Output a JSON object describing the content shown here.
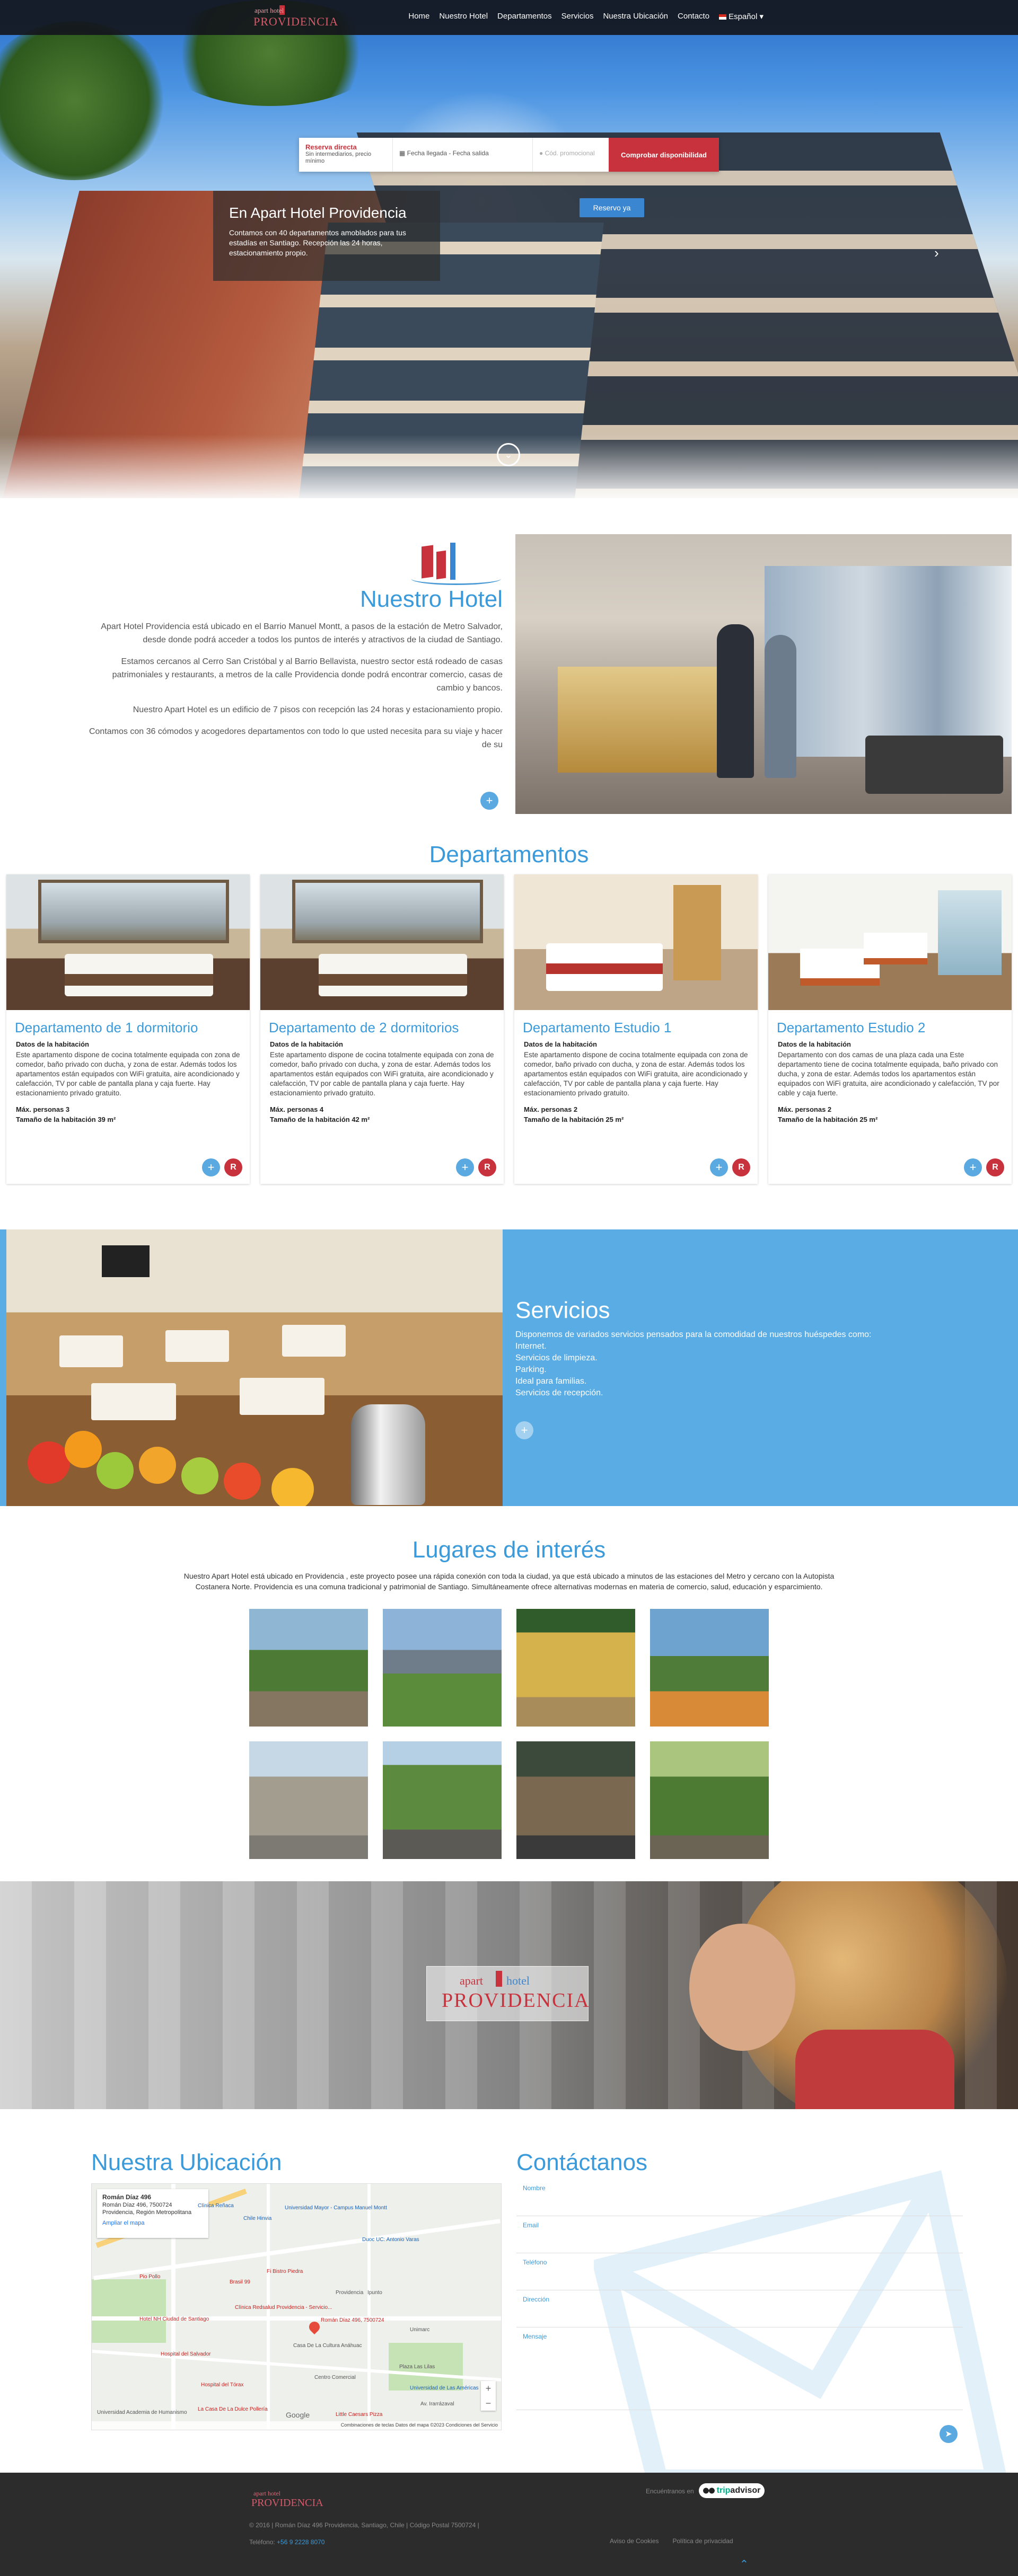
{
  "nav": {
    "logo_top": "apart hotel",
    "logo_main": "PROVIDENCIA",
    "items": [
      "Home",
      "Nuestro Hotel",
      "Departamentos",
      "Servicios",
      "Nuestra Ubicación",
      "Contacto"
    ],
    "language": "Español"
  },
  "booking": {
    "direct_title": "Reserva directa",
    "direct_sub": "Sin intermediarios, precio mínimo",
    "dates_placeholder": "Fecha llegada - Fecha salida",
    "promo_placeholder": "Cód. promocional",
    "check_button": "Comprobar disponibilidad"
  },
  "hero": {
    "title": "En Apart Hotel Providencia",
    "text": "Contamos con 40 departamentos amoblados para tus estadías en Santiago. Recepción las 24 horas, estacionamiento propio.",
    "reserve_button": "Reservo ya",
    "next_arrow": "›",
    "scroll_glyph": "⌄"
  },
  "hotel": {
    "title": "Nuestro Hotel",
    "paragraphs": [
      "Apart Hotel Providencia está ubicado en el Barrio Manuel Montt, a pasos de la estación de Metro Salvador, desde donde podrá acceder a todos los puntos de interés y atractivos de la ciudad de Santiago.",
      "Estamos cercanos al Cerro San Cristóbal y al Barrio Bellavista, nuestro sector está rodeado de casas patrimoniales y restaurants, a metros de la calle Providencia donde podrá encontrar comercio, casas de cambio y bancos.",
      "Nuestro Apart Hotel es un edificio de 7 pisos con recepción las 24 horas y estacionamiento propio.",
      "Contamos con 36 cómodos y acogedores departamentos con todo lo que usted necesita para su viaje y hacer de su"
    ],
    "more": "+"
  },
  "departamentos": {
    "title": "Departamentos",
    "cards": [
      {
        "title": "Departamento de 1 dormitorio",
        "label": "Datos de la habitación",
        "desc": "Este apartamento dispone de cocina totalmente equipada con zona de comedor, baño privado con ducha, y zona de estar. Además todos los apartamentos están equipados con WiFi gratuita, aire acondicionado y calefacción, TV por cable de pantalla plana y caja fuerte. Hay estacionamiento privado gratuito.",
        "max": "Máx. personas 3",
        "size": "Tamaño de la habitación 39 m²",
        "plus": "+",
        "r": "R"
      },
      {
        "title": "Departamento de 2 dormitorios",
        "label": "Datos de la habitación",
        "desc": "Este apartamento dispone de cocina totalmente equipada con zona de comedor, baño privado con ducha, y zona de estar. Además todos los apartamentos están equipados con WiFi gratuita, aire acondicionado y calefacción, TV por cable de pantalla plana y caja fuerte. Hay estacionamiento privado gratuito.",
        "max": "Máx. personas 4",
        "size": "Tamaño de la habitación 42 m²",
        "plus": "+",
        "r": "R"
      },
      {
        "title": "Departamento Estudio 1",
        "label": "Datos de la habitación",
        "desc": "Este apartamento dispone de cocina totalmente equipada con zona de comedor, baño privado con ducha, y zona de estar. Además todos los apartamentos están equipados con WiFi gratuita, aire acondicionado y calefacción, TV por cable de pantalla plana y caja fuerte. Hay estacionamiento privado gratuito.",
        "max": "Máx. personas 2",
        "size": "Tamaño de la habitación 25 m²",
        "plus": "+",
        "r": "R"
      },
      {
        "title": "Departamento Estudio 2",
        "label": "Datos de la habitación",
        "desc": "Departamento con dos camas de una plaza cada una Este departamento tiene de cocina totalmente equipada, baño privado con ducha, y zona de estar. Además todos los apartamentos están equipados con WiFi gratuita, aire acondicionado y calefacción, TV por cable y caja fuerte.",
        "max": "Máx. personas 2",
        "size": "Tamaño de la habitación 25 m²",
        "plus": "+",
        "r": "R"
      }
    ]
  },
  "servicios": {
    "title": "Servicios",
    "lines": [
      "Disponemos de variados servicios pensados para la comodidad de nuestros huéspedes como:",
      "Internet.",
      "Servicios de limpieza.",
      "Parking.",
      "Ideal para familias.",
      "Servicios de recepción."
    ],
    "more": "+"
  },
  "lugares": {
    "title": "Lugares de interés",
    "text": "Nuestro Apart Hotel está ubicado en Providencia , este proyecto posee una rápida conexión con toda la ciudad, ya que está ubicado a minutos de las estaciones del Metro y cercano con la Autopista Costanera Norte. Providencia es una comuna tradicional y patrimonial de Santiago. Simultáneamente ofrece alternativas modernas en materia de comercio, salud, educación y esparcimiento."
  },
  "banner": {
    "logo_apart": "apart",
    "logo_hotel": "hotel",
    "logo_name": "PROVIDENCIA"
  },
  "ubicacion": {
    "title": "Nuestra Ubicación",
    "map_place": "Román Díaz 496",
    "map_address": "Román Díaz 496, 7500724 Providencia, Región Metropolitana",
    "map_link": "Ampliar el mapa",
    "pin_label": "Román Díaz 496, 7500724",
    "pois": [
      "Clínica Redsalud Providencia - Servicio...",
      "Hospital del Salvador",
      "Hospital del Tórax",
      "Hotel NH Ciudad de Santiago",
      "Brasil 99",
      "Pio Pollo",
      "Fi Bistro Piedra",
      "Ipunto",
      "Casa De La Cultura Anáhuac",
      "Unimarc",
      "Plaza Las Lilas",
      "Centro Comercial",
      "La Casa De La Dulce Pollería",
      "Little Caesars Pizza",
      "Universidad Academia de Humanismo"
    ],
    "street_labels": [
      "Universidad Mayor - Campus Manuel Montt",
      "Chile Hinvia",
      "Clínica Reñaca",
      "Duoc UC: Antonio Varas",
      "Universidad de Las Américas",
      "Providencia",
      "Av. Irarrázaval"
    ],
    "zoom_in": "+",
    "zoom_out": "−",
    "google": "Google",
    "map_footer": "Combinaciones de teclas   Datos del mapa ©2023   Condiciones del Servicio"
  },
  "contacto": {
    "title": "Contáctanos",
    "fields": [
      "Nombre",
      "Email",
      "Teléfono",
      "Dirección",
      "Mensaje"
    ],
    "send": "➤"
  },
  "footer": {
    "logo_top": "apart hotel",
    "logo_main": "PROVIDENCIA",
    "copyright": "© 2016 | Román Díaz 496 Providencia, Santiago, Chile | Código Postal 7500724 |",
    "phone_label": "Teléfono: ",
    "phone": "+56 9 2228 8070",
    "find_us": "Encuéntranos en",
    "trip_a": "trip",
    "trip_b": "advisor",
    "links": [
      "Aviso de Cookies",
      "Política de privacidad"
    ],
    "up": "⌃"
  },
  "colors": {
    "accent_blue": "#3b9ad9",
    "brand_red": "#c8323c",
    "servicios_bg": "#5aace4",
    "footer_bg": "#2c2c2c"
  }
}
